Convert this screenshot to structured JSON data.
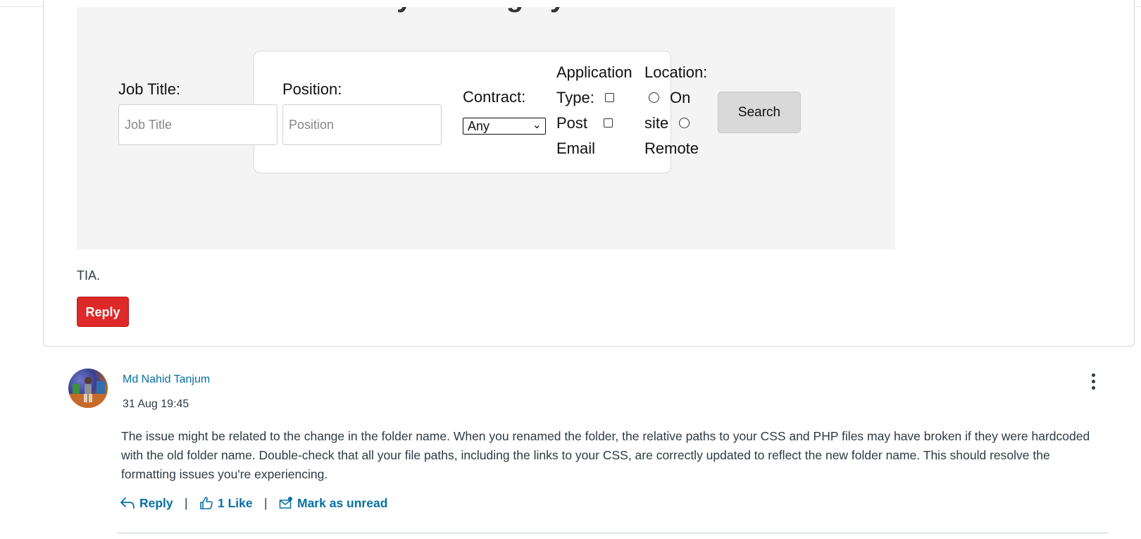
{
  "post": {
    "screenshot": {
      "title": "Job Vacancy Posting System",
      "form": {
        "job_title_label": "Job Title:",
        "job_title_placeholder": "Job Title",
        "position_label": "Position:",
        "position_placeholder": "Position",
        "contract_label": "Contract:",
        "contract_selected": "Any",
        "application_label": "Application",
        "type_label": "Type:",
        "post_label": "Post",
        "email_label": "Email",
        "location_label": "Location:",
        "on_label": "On",
        "site_label": "site",
        "remote_label": "Remote",
        "search_button": "Search"
      }
    },
    "closing_text": "TIA.",
    "reply_button": "Reply"
  },
  "reply": {
    "author": "Md Nahid Tanjum",
    "timestamp": "31 Aug 19:45",
    "body": "The issue might be related to the change in the folder name. When you renamed the folder, the relative paths to your CSS and PHP files may have broken if they were hardcoded with the old folder name. Double-check that all your file paths, including the links to your CSS, are correctly updated to reflect the new folder name. This should resolve the formatting issues you're experiencing.",
    "actions": {
      "reply": "Reply",
      "like": "1 Like",
      "mark_unread": "Mark as unread",
      "separator": "|"
    }
  },
  "colors": {
    "reply_button": "#df2828",
    "link": "#0770a3",
    "text": "#2d3b45"
  },
  "icons": [
    "reply-arrow-icon",
    "thumbs-up-icon",
    "mail-unread-icon",
    "more-options-icon"
  ]
}
